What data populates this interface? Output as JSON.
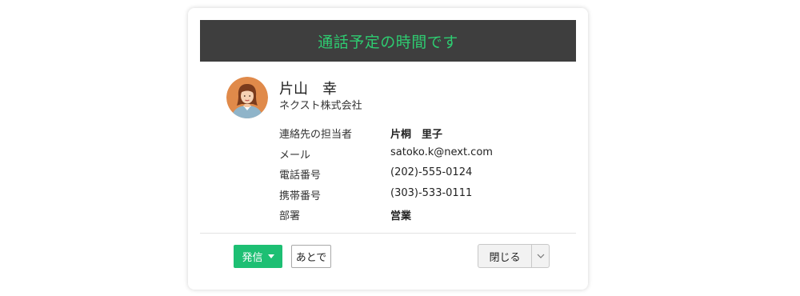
{
  "colors": {
    "header_bg": "#3e3e3e",
    "header_text": "#2ecc71",
    "primary_button": "#1dbf73"
  },
  "header": {
    "title": "通話予定の時間です"
  },
  "contact": {
    "avatar_icon": "woman-avatar-icon",
    "name": "片山　幸",
    "company": "ネクスト株式会社"
  },
  "details": [
    {
      "label": "連絡先の担当者",
      "value": "片桐　里子"
    },
    {
      "label": "メール",
      "value": "satoko.k@next.com"
    },
    {
      "label": "電話番号",
      "value": "(202)-555-0124"
    },
    {
      "label": "携帯番号",
      "value": "(303)-533-0111"
    },
    {
      "label": "部署",
      "value": "営業"
    }
  ],
  "footer": {
    "call_label": "発信",
    "later_label": "あとで",
    "close_label": "閉じる"
  }
}
